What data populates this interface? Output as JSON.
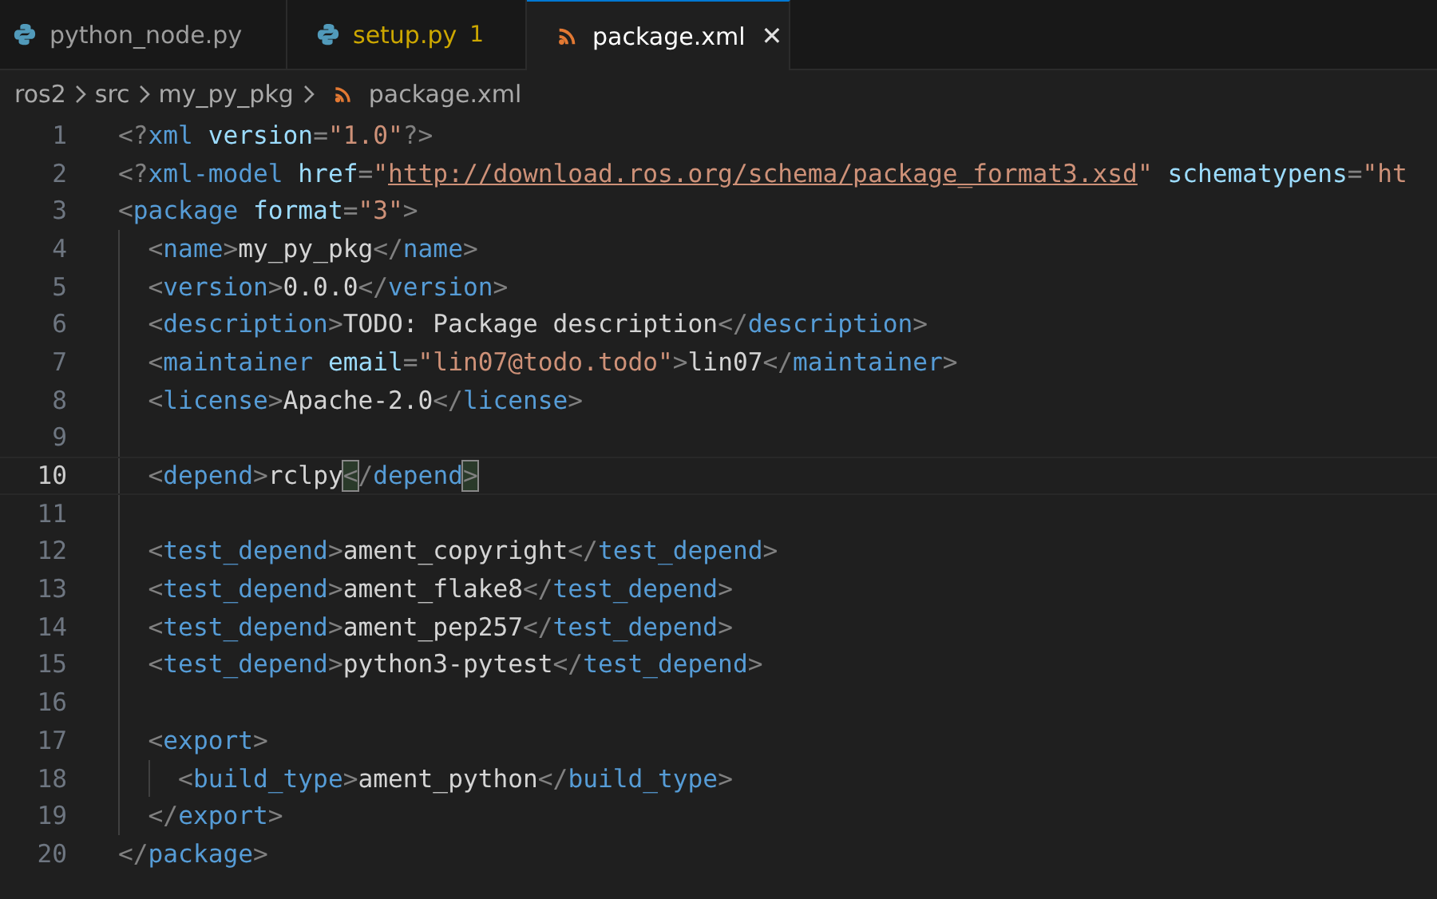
{
  "tabs": [
    {
      "label": "python_node.py",
      "warning": false,
      "selected": false
    },
    {
      "label": "setup.py",
      "warning": true,
      "badge": "1",
      "selected": false
    },
    {
      "label": "package.xml",
      "warning": false,
      "selected": true,
      "close": "✕"
    }
  ],
  "breadcrumb": [
    {
      "label": "ros2"
    },
    {
      "label": "src"
    },
    {
      "label": "my_py_pkg"
    },
    {
      "label": "package.xml"
    }
  ],
  "editor": {
    "lines": [
      {
        "number": "1",
        "selected": false,
        "tokens": [
          {
            "kind": "punct",
            "text": "<?"
          },
          {
            "kind": "tag",
            "text": "xml"
          },
          {
            "kind": "attr",
            "text": " version"
          },
          {
            "kind": "punct",
            "text": "="
          },
          {
            "kind": "string",
            "text": "\"1.0\""
          },
          {
            "kind": "punct",
            "text": "?>"
          }
        ]
      },
      {
        "number": "2",
        "selected": false,
        "tokens": [
          {
            "kind": "punct",
            "text": "<?"
          },
          {
            "kind": "tag",
            "text": "xml-model"
          },
          {
            "kind": "attr",
            "text": " href"
          },
          {
            "kind": "punct",
            "text": "="
          },
          {
            "kind": "string",
            "text": "\""
          },
          {
            "kind": "url",
            "text": "http://download.ros.org/schema/package_format3.xsd"
          },
          {
            "kind": "string",
            "text": "\""
          },
          {
            "kind": "attr",
            "text": " schematypens"
          },
          {
            "kind": "punct",
            "text": "="
          },
          {
            "kind": "string",
            "text": "\"ht"
          }
        ]
      },
      {
        "number": "3",
        "selected": false,
        "tokens": [
          {
            "kind": "punct",
            "text": "<"
          },
          {
            "kind": "tag",
            "text": "package"
          },
          {
            "kind": "attr",
            "text": " format"
          },
          {
            "kind": "punct",
            "text": "="
          },
          {
            "kind": "string",
            "text": "\"3\""
          },
          {
            "kind": "punct",
            "text": ">"
          }
        ]
      },
      {
        "number": "4",
        "selected": false,
        "tokens": [
          {
            "kind": "punct",
            "text": "  <"
          },
          {
            "kind": "tag",
            "text": "name"
          },
          {
            "kind": "punct",
            "text": ">"
          },
          {
            "kind": "text",
            "text": "my_py_pkg"
          },
          {
            "kind": "punct",
            "text": "</"
          },
          {
            "kind": "tag",
            "text": "name"
          },
          {
            "kind": "punct",
            "text": ">"
          }
        ]
      },
      {
        "number": "5",
        "selected": false,
        "tokens": [
          {
            "kind": "punct",
            "text": "  <"
          },
          {
            "kind": "tag",
            "text": "version"
          },
          {
            "kind": "punct",
            "text": ">"
          },
          {
            "kind": "text",
            "text": "0.0.0"
          },
          {
            "kind": "punct",
            "text": "</"
          },
          {
            "kind": "tag",
            "text": "version"
          },
          {
            "kind": "punct",
            "text": ">"
          }
        ]
      },
      {
        "number": "6",
        "selected": false,
        "tokens": [
          {
            "kind": "punct",
            "text": "  <"
          },
          {
            "kind": "tag",
            "text": "description"
          },
          {
            "kind": "punct",
            "text": ">"
          },
          {
            "kind": "text",
            "text": "TODO: Package description"
          },
          {
            "kind": "punct",
            "text": "</"
          },
          {
            "kind": "tag",
            "text": "description"
          },
          {
            "kind": "punct",
            "text": ">"
          }
        ]
      },
      {
        "number": "7",
        "selected": false,
        "tokens": [
          {
            "kind": "punct",
            "text": "  <"
          },
          {
            "kind": "tag",
            "text": "maintainer"
          },
          {
            "kind": "attr",
            "text": " email"
          },
          {
            "kind": "punct",
            "text": "="
          },
          {
            "kind": "string",
            "text": "\"lin07@todo.todo\""
          },
          {
            "kind": "punct",
            "text": ">"
          },
          {
            "kind": "text",
            "text": "lin07"
          },
          {
            "kind": "punct",
            "text": "</"
          },
          {
            "kind": "tag",
            "text": "maintainer"
          },
          {
            "kind": "punct",
            "text": ">"
          }
        ]
      },
      {
        "number": "8",
        "selected": false,
        "tokens": [
          {
            "kind": "punct",
            "text": "  <"
          },
          {
            "kind": "tag",
            "text": "license"
          },
          {
            "kind": "punct",
            "text": ">"
          },
          {
            "kind": "text",
            "text": "Apache-2.0"
          },
          {
            "kind": "punct",
            "text": "</"
          },
          {
            "kind": "tag",
            "text": "license"
          },
          {
            "kind": "punct",
            "text": ">"
          }
        ]
      },
      {
        "number": "9",
        "selected": false
      },
      {
        "number": "10",
        "selected": true,
        "tokens": [
          {
            "kind": "punct",
            "text": "  <"
          },
          {
            "kind": "tag",
            "text": "depend"
          },
          {
            "kind": "punct",
            "text": ">"
          },
          {
            "kind": "text",
            "text": "rclpy"
          },
          {
            "kind": "match",
            "text": "<"
          },
          {
            "kind": "punct",
            "text": "/"
          },
          {
            "kind": "tag",
            "text": "depend"
          },
          {
            "kind": "match",
            "text": ">"
          }
        ]
      },
      {
        "number": "11",
        "selected": false
      },
      {
        "number": "12",
        "selected": false,
        "tokens": [
          {
            "kind": "punct",
            "text": "  <"
          },
          {
            "kind": "tag",
            "text": "test_depend"
          },
          {
            "kind": "punct",
            "text": ">"
          },
          {
            "kind": "text",
            "text": "ament_copyright"
          },
          {
            "kind": "punct",
            "text": "</"
          },
          {
            "kind": "tag",
            "text": "test_depend"
          },
          {
            "kind": "punct",
            "text": ">"
          }
        ]
      },
      {
        "number": "13",
        "selected": false,
        "tokens": [
          {
            "kind": "punct",
            "text": "  <"
          },
          {
            "kind": "tag",
            "text": "test_depend"
          },
          {
            "kind": "punct",
            "text": ">"
          },
          {
            "kind": "text",
            "text": "ament_flake8"
          },
          {
            "kind": "punct",
            "text": "</"
          },
          {
            "kind": "tag",
            "text": "test_depend"
          },
          {
            "kind": "punct",
            "text": ">"
          }
        ]
      },
      {
        "number": "14",
        "selected": false,
        "tokens": [
          {
            "kind": "punct",
            "text": "  <"
          },
          {
            "kind": "tag",
            "text": "test_depend"
          },
          {
            "kind": "punct",
            "text": ">"
          },
          {
            "kind": "text",
            "text": "ament_pep257"
          },
          {
            "kind": "punct",
            "text": "</"
          },
          {
            "kind": "tag",
            "text": "test_depend"
          },
          {
            "kind": "punct",
            "text": ">"
          }
        ]
      },
      {
        "number": "15",
        "selected": false,
        "tokens": [
          {
            "kind": "punct",
            "text": "  <"
          },
          {
            "kind": "tag",
            "text": "test_depend"
          },
          {
            "kind": "punct",
            "text": ">"
          },
          {
            "kind": "text",
            "text": "python3-pytest"
          },
          {
            "kind": "punct",
            "text": "</"
          },
          {
            "kind": "tag",
            "text": "test_depend"
          },
          {
            "kind": "punct",
            "text": ">"
          }
        ]
      },
      {
        "number": "16",
        "selected": false
      },
      {
        "number": "17",
        "selected": false,
        "tokens": [
          {
            "kind": "punct",
            "text": "  <"
          },
          {
            "kind": "tag",
            "text": "export"
          },
          {
            "kind": "punct",
            "text": ">"
          }
        ]
      },
      {
        "number": "18",
        "selected": false,
        "tokens": [
          {
            "kind": "punct",
            "text": "    <"
          },
          {
            "kind": "tag",
            "text": "build_type"
          },
          {
            "kind": "punct",
            "text": ">"
          },
          {
            "kind": "text",
            "text": "ament_python"
          },
          {
            "kind": "punct",
            "text": "</"
          },
          {
            "kind": "tag",
            "text": "build_type"
          },
          {
            "kind": "punct",
            "text": ">"
          }
        ]
      },
      {
        "number": "19",
        "selected": false,
        "tokens": [
          {
            "kind": "punct",
            "text": "  </"
          },
          {
            "kind": "tag",
            "text": "export"
          },
          {
            "kind": "punct",
            "text": ">"
          }
        ]
      },
      {
        "number": "20",
        "selected": false,
        "tokens": [
          {
            "kind": "punct",
            "text": "</"
          },
          {
            "kind": "tag",
            "text": "package"
          },
          {
            "kind": "punct",
            "text": ">"
          }
        ]
      }
    ]
  }
}
